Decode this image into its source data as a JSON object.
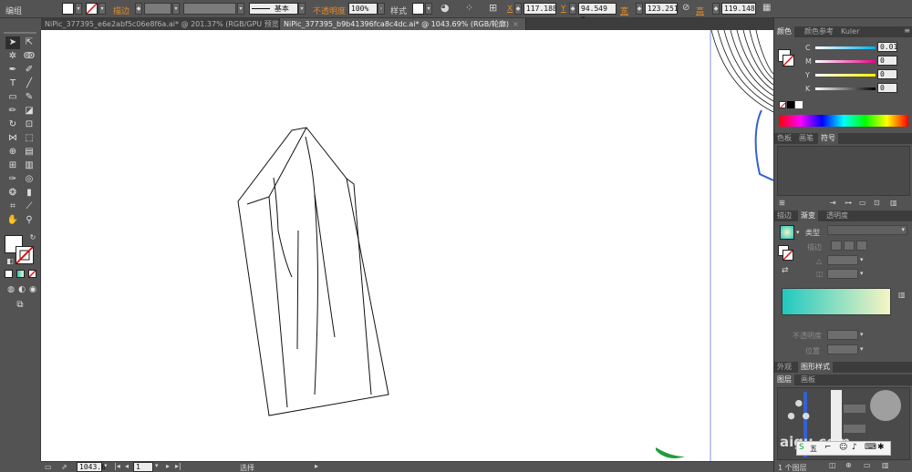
{
  "control_bar": {
    "selection_label": "编组",
    "stroke_label": "描边",
    "brush_label": "基本",
    "opacity_label": "不透明度",
    "opacity_value": "100%",
    "style_label": "样式",
    "x_label": "X",
    "x_value": "117.188",
    "y_label": "Y",
    "y_value": "94.549 m",
    "w_label": "宽",
    "w_value": "123.251",
    "h_label": "高",
    "h_value": "119.148"
  },
  "doc_tabs": [
    {
      "label": "NiPic_377395_e6e2abf5c06e8f6a.ai* @ 201.37% (RGB/GPU 预览)",
      "active": false
    },
    {
      "label": "NiPic_377395_b9b41396fca8c4dc.ai* @ 1043.69% (RGB/轮廓)",
      "active": true
    }
  ],
  "color_panel": {
    "tabs": [
      "颜色",
      "颜色参考",
      "Kuler"
    ],
    "channels": [
      {
        "name": "C",
        "value": "0.01"
      },
      {
        "name": "M",
        "value": "0"
      },
      {
        "name": "Y",
        "value": "0"
      },
      {
        "name": "K",
        "value": "0"
      }
    ]
  },
  "swatch_panel": {
    "tabs": [
      "色板",
      "画笔",
      "符号"
    ]
  },
  "gradient_panel": {
    "tabs": [
      "描边",
      "渐变",
      "透明度"
    ],
    "type_label": "类型",
    "stroke_label": "描边",
    "opacity_label": "不透明度",
    "position_label": "位置",
    "start_color": "#20c9bf",
    "end_color": "#f7f4c4"
  },
  "appearance_panel": {
    "tabs": [
      "外观",
      "图形样式"
    ]
  },
  "layers_panel": {
    "tabs": [
      "图层",
      "画板"
    ],
    "footer": "1 个图层"
  },
  "status_bar": {
    "zoom": "1043.6",
    "page": "1",
    "mode": "选择"
  },
  "watermark": {
    "text": "aigu.com"
  },
  "colors": {
    "accent": "#e28b2c",
    "canvas": "#ffffff",
    "ui": "#535353"
  }
}
